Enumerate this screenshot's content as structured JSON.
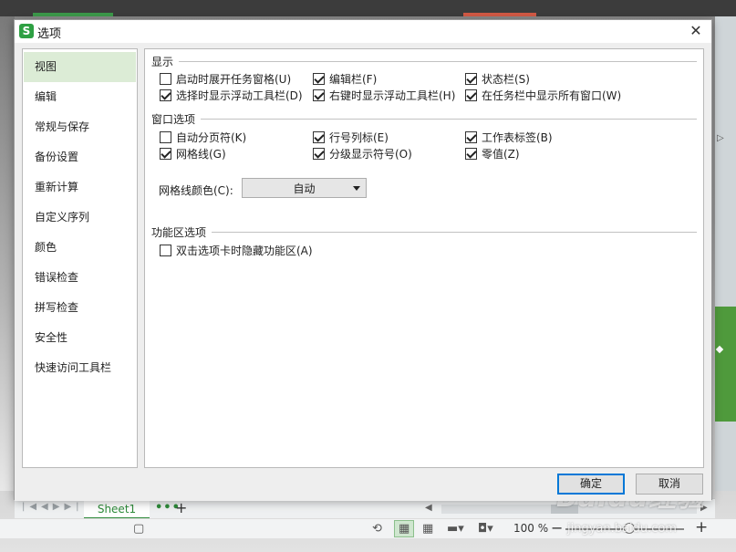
{
  "dialog": {
    "title": "选项",
    "app_logo_text": "S",
    "close_glyph": "✕",
    "ok_label": "确定",
    "cancel_label": "取消"
  },
  "sidebar": {
    "items": [
      {
        "label": "视图",
        "active": true
      },
      {
        "label": "编辑"
      },
      {
        "label": "常规与保存"
      },
      {
        "label": "备份设置"
      },
      {
        "label": "重新计算"
      },
      {
        "label": "自定义序列"
      },
      {
        "label": "颜色"
      },
      {
        "label": "错误检查"
      },
      {
        "label": "拼写检查"
      },
      {
        "label": "安全性"
      },
      {
        "label": "快速访问工具栏"
      }
    ]
  },
  "sections": {
    "display": {
      "title": "显示",
      "options": [
        {
          "label": "启动时展开任务窗格(U)",
          "checked": false
        },
        {
          "label": "编辑栏(F)",
          "checked": true
        },
        {
          "label": "状态栏(S)",
          "checked": true
        },
        {
          "label": "选择时显示浮动工具栏(D)",
          "checked": true
        },
        {
          "label": "右键时显示浮动工具栏(H)",
          "checked": true
        },
        {
          "label": "在任务栏中显示所有窗口(W)",
          "checked": true
        }
      ]
    },
    "window": {
      "title": "窗口选项",
      "options": [
        {
          "label": "自动分页符(K)",
          "checked": false
        },
        {
          "label": "行号列标(E)",
          "checked": true
        },
        {
          "label": "工作表标签(B)",
          "checked": true
        },
        {
          "label": "网格线(G)",
          "checked": true
        },
        {
          "label": "分级显示符号(O)",
          "checked": true
        },
        {
          "label": "零值(Z)",
          "checked": true
        }
      ],
      "gridline_color_label": "网格线颜色(C):",
      "gridline_color_value": "自动"
    },
    "ribbon": {
      "title": "功能区选项",
      "options": [
        {
          "label": "双击选项卡时隐藏功能区(A)",
          "checked": false
        }
      ]
    }
  },
  "background": {
    "sheet_tab": "Sheet1",
    "sheet_more": "•••",
    "sheet_add": "+",
    "zoom": "100 %",
    "zoom_minus": "−",
    "zoom_plus": "+",
    "watermark": "Baidu经验",
    "watermark_sub": "jingyan.baidu.com"
  },
  "colors": {
    "accent_green": "#2ea043",
    "sidebar_active": "#dcecd6",
    "ok_border": "#0078d7"
  }
}
